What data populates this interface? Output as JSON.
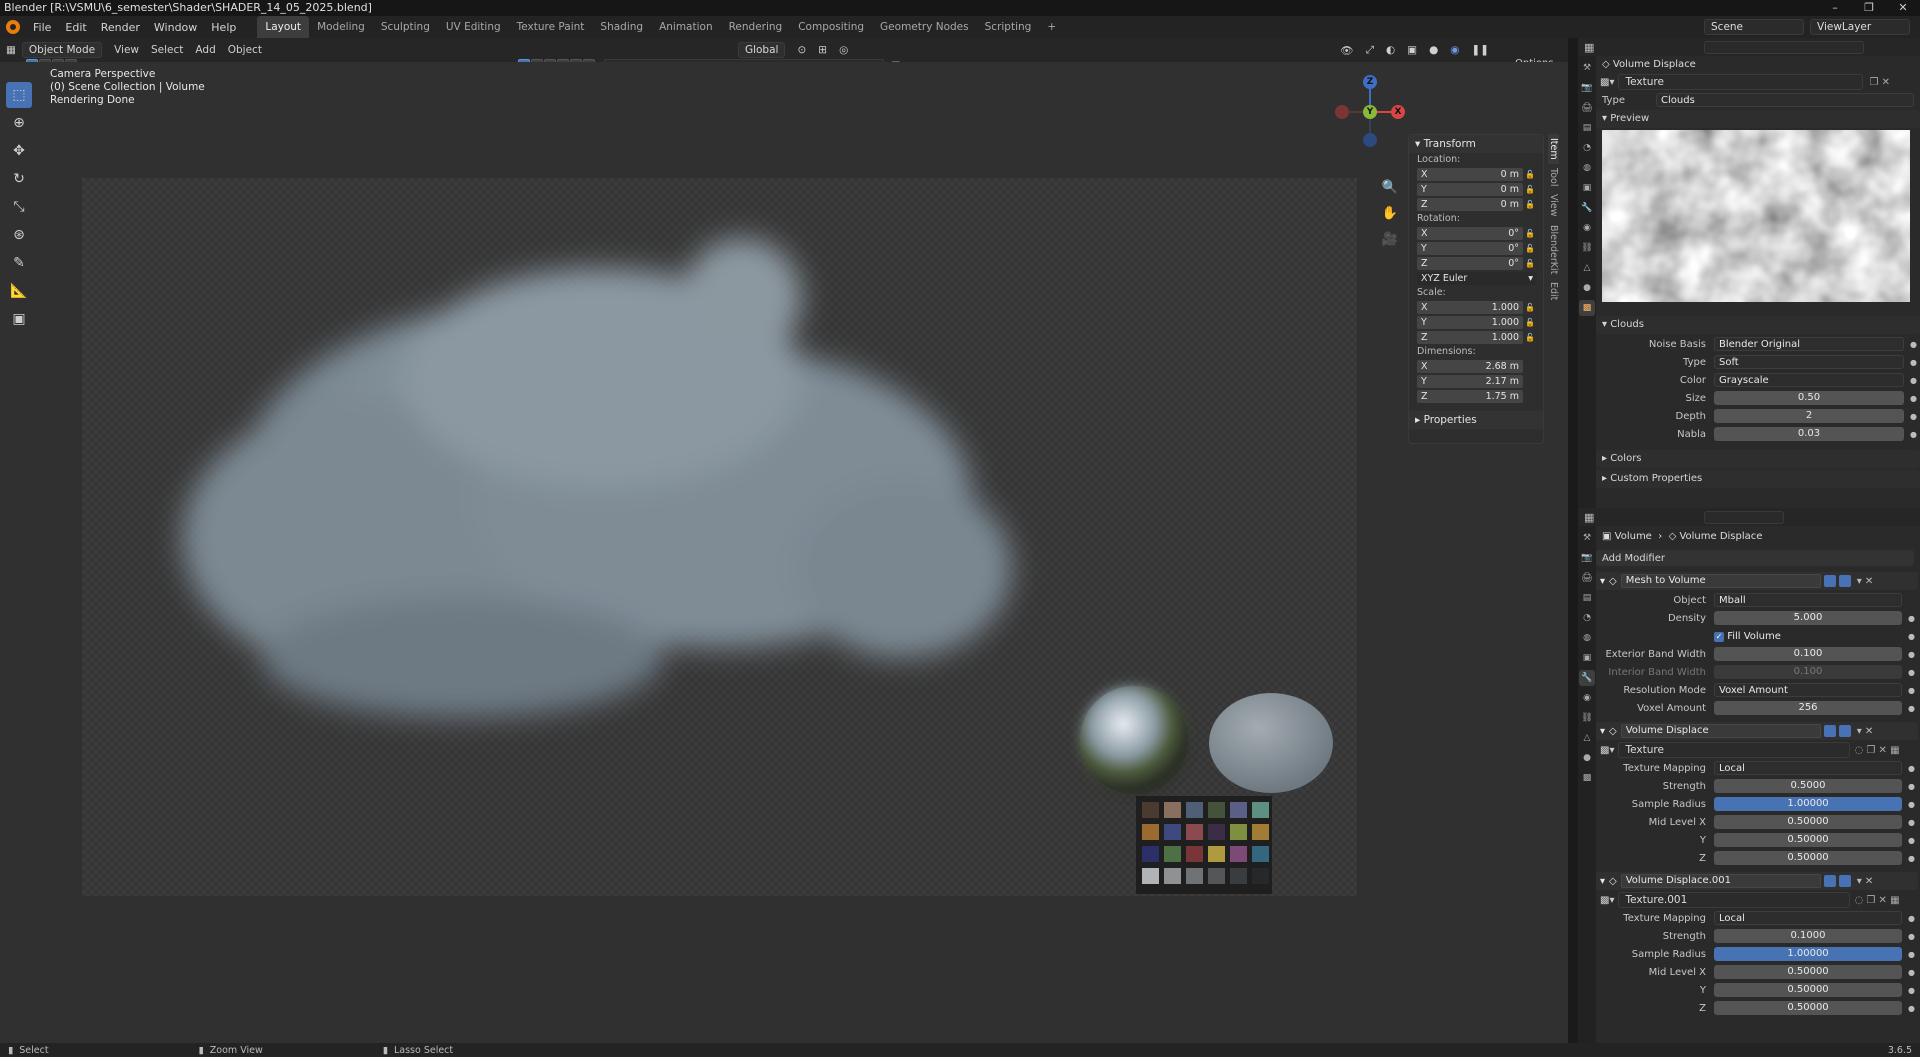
{
  "title": "Blender [R:\\VSMU\\6_semester\\Shader\\SHADER_14_05_2025.blend]",
  "window_controls": [
    "–",
    "❐",
    "✕"
  ],
  "menu": [
    "File",
    "Edit",
    "Render",
    "Window",
    "Help"
  ],
  "workspaces": [
    "Layout",
    "Modeling",
    "Sculpting",
    "UV Editing",
    "Texture Paint",
    "Shading",
    "Animation",
    "Rendering",
    "Compositing",
    "Geometry Nodes",
    "Scripting"
  ],
  "add_workspace": "+",
  "scene": "Scene",
  "view_layer": "ViewLayer",
  "viewport_header": {
    "mode": "Object Mode",
    "menus": [
      "View",
      "Select",
      "Add",
      "Object"
    ],
    "transform_orientation": "Global",
    "options": "Options"
  },
  "viewport": {
    "overlay_lines": [
      "Camera Perspective",
      "(0) Scene Collection | Volume",
      "Rendering Done"
    ],
    "gizmo": {
      "x": "X",
      "y": "Y",
      "z": "Z"
    }
  },
  "transform": {
    "header": "Transform",
    "location_label": "Location:",
    "location": [
      {
        "axis": "X",
        "value": "0 m"
      },
      {
        "axis": "Y",
        "value": "0 m"
      },
      {
        "axis": "Z",
        "value": "0 m"
      }
    ],
    "rotation_label": "Rotation:",
    "rotation": [
      {
        "axis": "X",
        "value": "0°"
      },
      {
        "axis": "Y",
        "value": "0°"
      },
      {
        "axis": "Z",
        "value": "0°"
      }
    ],
    "rotation_mode": "XYZ Euler",
    "scale_label": "Scale:",
    "scale": [
      {
        "axis": "X",
        "value": "1.000"
      },
      {
        "axis": "Y",
        "value": "1.000"
      },
      {
        "axis": "Z",
        "value": "1.000"
      }
    ],
    "dimensions_label": "Dimensions:",
    "dimensions": [
      {
        "axis": "X",
        "value": "2.68 m"
      },
      {
        "axis": "Y",
        "value": "2.17 m"
      },
      {
        "axis": "Z",
        "value": "1.75 m"
      }
    ],
    "properties": "Properties"
  },
  "n_tabs": [
    "Item",
    "Tool",
    "View",
    "BlenderKit",
    "Edit"
  ],
  "texture_panel": {
    "breadcrumb": "Volume Displace",
    "texture_name": "Texture",
    "type_label": "Type",
    "type_value": "Clouds",
    "preview": "Preview",
    "clouds_section": "Clouds",
    "rows": [
      {
        "label": "Noise Basis",
        "value": "Blender Original",
        "kind": "dd"
      },
      {
        "label": "Type",
        "value": "Soft",
        "kind": "dd"
      },
      {
        "label": "Color",
        "value": "Grayscale",
        "kind": "dd"
      },
      {
        "label": "Size",
        "value": "0.50",
        "kind": "num"
      },
      {
        "label": "Depth",
        "value": "2",
        "kind": "num"
      },
      {
        "label": "Nabla",
        "value": "0.03",
        "kind": "num"
      }
    ],
    "colors": "Colors",
    "custom_properties": "Custom Properties"
  },
  "modifier_panel": {
    "breadcrumb_object": "Volume",
    "breadcrumb_modifier": "Volume Displace",
    "add_modifier": "Add Modifier",
    "mesh_to_volume": {
      "name": "Mesh to Volume",
      "object_label": "Object",
      "object_value": "Mball",
      "density_label": "Density",
      "density": "5.000",
      "fill_volume": "Fill Volume",
      "exterior_label": "Exterior Band Width",
      "exterior": "0.100",
      "interior_label": "Interior Band Width",
      "interior": "0.100",
      "resolution_label": "Resolution Mode",
      "resolution": "Voxel Amount",
      "voxel_label": "Voxel Amount",
      "voxel": "256"
    },
    "displace1": {
      "name": "Volume Displace",
      "texture": "Texture",
      "mapping_label": "Texture Mapping",
      "mapping": "Local",
      "strength_label": "Strength",
      "strength": "0.5000",
      "radius_label": "Sample Radius",
      "radius": "1.00000",
      "midx_label": "Mid Level X",
      "midx": "0.50000",
      "midy_label": "Y",
      "midy": "0.50000",
      "midz_label": "Z",
      "midz": "0.50000"
    },
    "displace2": {
      "name": "Volume Displace.001",
      "texture": "Texture.001",
      "mapping_label": "Texture Mapping",
      "mapping": "Local",
      "strength_label": "Strength",
      "strength": "0.1000",
      "radius_label": "Sample Radius",
      "radius": "1.00000",
      "midx_label": "Mid Level X",
      "midx": "0.50000",
      "midy_label": "Y",
      "midy": "0.50000",
      "midz_label": "Z",
      "midz": "0.50000"
    }
  },
  "status": {
    "select": "Select",
    "zoom": "Zoom View",
    "lasso": "Lasso Select",
    "version": "3.6.5"
  },
  "colors": {
    "accent": "#4772b3",
    "blender_orange": "#e87d0d",
    "axis_x": "#d94545",
    "axis_y": "#8ab83a",
    "axis_z": "#3f6fc4"
  }
}
